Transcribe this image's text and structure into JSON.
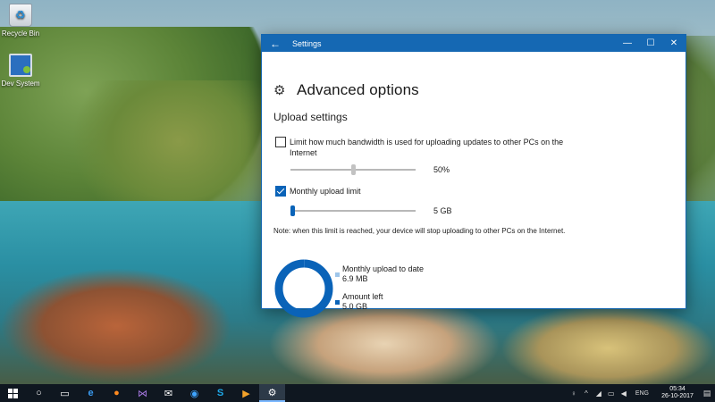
{
  "desktop": {
    "icons": [
      {
        "label": "Recycle Bin",
        "icon": "recycle-bin-icon"
      },
      {
        "label": "Dev System",
        "icon": "computer-icon"
      }
    ]
  },
  "window": {
    "title": "Settings",
    "accent": "#1568b3",
    "page_title": "Advanced options",
    "section_title": "Upload settings",
    "bandwidth": {
      "label": "Limit how much bandwidth is used for uploading updates to other PCs on the Internet",
      "checked": false,
      "slider_percent": 0.5,
      "value": "50%"
    },
    "monthly": {
      "label": "Monthly upload limit",
      "checked": true,
      "slider_percent": 0.0,
      "value": "5 GB"
    },
    "note": "Note: when this limit is reached, your device will stop uploading to other PCs on the Internet.",
    "usage": {
      "uploaded_label": "Monthly upload to date",
      "uploaded_value": "6.9 MB",
      "uploaded_color": "#9fc6ea",
      "left_label": "Amount left",
      "left_value": "5.0 GB",
      "left_color": "#0a63b8",
      "uploaded_fraction": 0.0013
    }
  },
  "taskbar": {
    "apps": [
      "start-icon",
      "cortana-icon",
      "task-view-icon",
      "edge-icon",
      "firefox-icon",
      "visual-studio-icon",
      "mail-icon",
      "teamviewer-icon",
      "skype-icon",
      "media-player-icon",
      "settings-icon"
    ],
    "language": "ENG",
    "time": "05:34",
    "date": "26-10-2017"
  }
}
